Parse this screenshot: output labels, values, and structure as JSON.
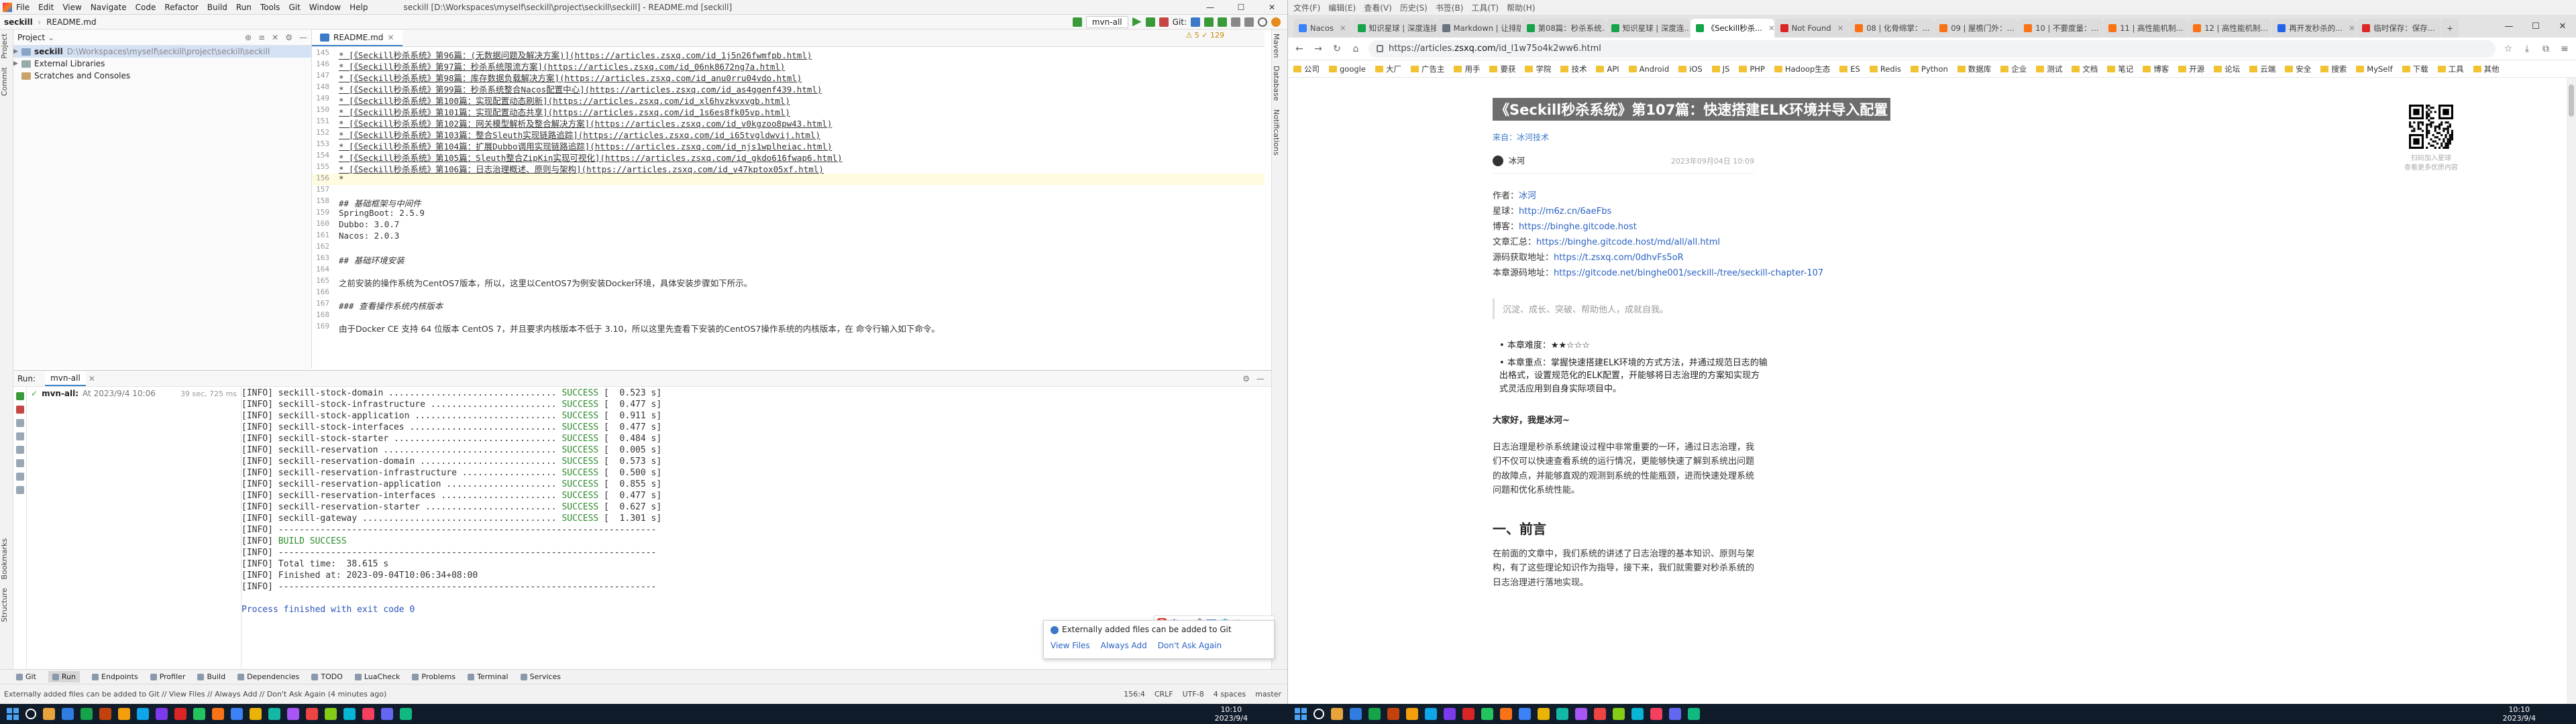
{
  "ide": {
    "title_menu": [
      "File",
      "Edit",
      "View",
      "Navigate",
      "Code",
      "Refactor",
      "Build",
      "Run",
      "Tools",
      "Git",
      "Window",
      "Help"
    ],
    "window_title": "seckill [D:\\Workspaces\\myself\\seckill\\project\\seckill\\seckill] - README.md [seckill]",
    "breadcrumb": [
      "seckill",
      "README.md"
    ],
    "run_config": "mvn-all",
    "git_label": "Git:",
    "project": {
      "header": "Project",
      "root_name": "seckill",
      "root_path": "D:\\Workspaces\\myself\\seckill\\project\\seckill\\seckill",
      "items": [
        "External Libraries",
        "Scratches and Consoles"
      ]
    },
    "editor_tab": "README.md",
    "warn_badge": "⚠ 5  ✓ 129",
    "code_lines": [
      {
        "n": "145",
        "t": "* [《Seckill秒杀系统》第96篇：(无数据问题及解决方案)](https://articles.zsxq.com/id_1j5n26fwmfpb.html)",
        "cls": "lk"
      },
      {
        "n": "146",
        "t": "* [《Seckill秒杀系统》第97篇：秒杀系统限流方案](https://articles.zsxq.com/id_06nk8672ng7a.html)",
        "cls": "lk"
      },
      {
        "n": "147",
        "t": "* [《Seckill秒杀系统》第98篇：库存数据负载解决方案](https://articles.zsxq.com/id_anu0rru04vdo.html)",
        "cls": "lk"
      },
      {
        "n": "148",
        "t": "* [《Seckill秒杀系统》第99篇：秒杀系统整合Nacos配置中心](https://articles.zsxq.com/id_as4ggenf439.html)",
        "cls": "lk"
      },
      {
        "n": "149",
        "t": "* [《Seckill秒杀系统》第100篇：实现配置动态刷新](https://articles.zsxq.com/id_xl6hvzkvxvgb.html)",
        "cls": "lk"
      },
      {
        "n": "150",
        "t": "* [《Seckill秒杀系统》第101篇：实现配置动态共享](https://articles.zsxq.com/id_1s6es8fk05vp.html)",
        "cls": "lk"
      },
      {
        "n": "151",
        "t": "* [《Seckill秒杀系统》第102篇：网关模型解析及整合解决方案](https://articles.zsxq.com/id_v0kgzoo8pw43.html)",
        "cls": "lk"
      },
      {
        "n": "152",
        "t": "* [《Seckill秒杀系统》第103篇：整合Sleuth实现链路追踪](https://articles.zsxq.com/id_i65tvgldwvij.html)",
        "cls": "lk"
      },
      {
        "n": "153",
        "t": "* [《Seckill秒杀系统》第104篇：扩展Dubbo调用实现链路追踪](https://articles.zsxq.com/id_njs1wplheiac.html)",
        "cls": "lk"
      },
      {
        "n": "154",
        "t": "* [《Seckill秒杀系统》第105篇：Sleuth整合ZipKin实现可视化](https://articles.zsxq.com/id_gkdo616fwap6.html)",
        "cls": "lk"
      },
      {
        "n": "155",
        "t": "* [《Seckill秒杀系统》第106篇：日志治理概述、原则与架构](https://articles.zsxq.com/id_v47kptox05xf.html)",
        "cls": "lk"
      },
      {
        "n": "156",
        "t": "*",
        "cls": "caret"
      },
      {
        "n": "157",
        "t": "",
        "cls": ""
      },
      {
        "n": "158",
        "t": "## 基础框架与中间件",
        "cls": "hd"
      },
      {
        "n": "159",
        "t": "SpringBoot: 2.5.9",
        "cls": ""
      },
      {
        "n": "160",
        "t": "Dubbo: 3.0.7",
        "cls": ""
      },
      {
        "n": "161",
        "t": "Nacos: 2.0.3",
        "cls": ""
      },
      {
        "n": "162",
        "t": "",
        "cls": ""
      },
      {
        "n": "163",
        "t": "## 基础环境安装",
        "cls": "hd"
      },
      {
        "n": "164",
        "t": "",
        "cls": ""
      },
      {
        "n": "165",
        "t": "之前安装的操作系统为CentOS7版本，所以，这里以CentOS7为例安装Docker环境，具体安装步骤如下所示。",
        "cls": "plain"
      },
      {
        "n": "166",
        "t": "",
        "cls": ""
      },
      {
        "n": "167",
        "t": "### 查看操作系统内核版本",
        "cls": "hd"
      },
      {
        "n": "168",
        "t": "",
        "cls": ""
      },
      {
        "n": "169",
        "t": "由于Docker CE 支持 64 位版本 CentOS 7，并且要求内核版本不低于 3.10，所以这里先查看下安装的CentOS7操作系统的内核版本，在 命令行输入如下命令。",
        "cls": "plain"
      }
    ],
    "run": {
      "label": "Run:",
      "tab": "mvn-all",
      "tree_item": "mvn-all:",
      "tree_time_label": "At 2023/9/4 10:06",
      "tree_time": "39 sec, 725 ms"
    },
    "console_lines": [
      [
        "[INFO] seckill-stock-domain ................................ ",
        "SUCCESS",
        " [  0.523 s]"
      ],
      [
        "[INFO] seckill-stock-infrastructure ........................ ",
        "SUCCESS",
        " [  0.477 s]"
      ],
      [
        "[INFO] seckill-stock-application ........................... ",
        "SUCCESS",
        " [  0.911 s]"
      ],
      [
        "[INFO] seckill-stock-interfaces ............................ ",
        "SUCCESS",
        " [  0.477 s]"
      ],
      [
        "[INFO] seckill-stock-starter ............................... ",
        "SUCCESS",
        " [  0.484 s]"
      ],
      [
        "[INFO] seckill-reservation ................................. ",
        "SUCCESS",
        " [  0.005 s]"
      ],
      [
        "[INFO] seckill-reservation-domain .......................... ",
        "SUCCESS",
        " [  0.573 s]"
      ],
      [
        "[INFO] seckill-reservation-infrastructure .................. ",
        "SUCCESS",
        " [  0.500 s]"
      ],
      [
        "[INFO] seckill-reservation-application ..................... ",
        "SUCCESS",
        " [  0.855 s]"
      ],
      [
        "[INFO] seckill-reservation-interfaces ...................... ",
        "SUCCESS",
        " [  0.477 s]"
      ],
      [
        "[INFO] seckill-reservation-starter ......................... ",
        "SUCCESS",
        " [  0.627 s]"
      ],
      [
        "[INFO] seckill-gateway ..................................... ",
        "SUCCESS",
        " [  1.301 s]"
      ]
    ],
    "console_tail": {
      "sep1": "[INFO] ------------------------------------------------------------------------",
      "build_prefix": "[INFO] ",
      "build": "BUILD SUCCESS",
      "sep2": "[INFO] ------------------------------------------------------------------------",
      "total": "[INFO] Total time:  38.615 s",
      "finished": "[INFO] Finished at: 2023-09-04T10:06:34+08:00",
      "sep3": "[INFO] ------------------------------------------------------------------------",
      "exit": "Process finished with exit code 0"
    },
    "notification": {
      "text": "Externally added files can be added to Git",
      "actions": [
        "View Files",
        "Always Add",
        "Don't Ask Again"
      ]
    },
    "ime": [
      "中",
      "•,",
      "🎤",
      "⌨",
      "👕",
      "▦"
    ],
    "bottom_tabs": [
      "Git",
      "Run",
      "Endpoints",
      "Profiler",
      "Build",
      "Dependencies",
      "TODO",
      "LuaCheck",
      "Problems",
      "Terminal",
      "Services"
    ],
    "status_left": "Externally added files can be added to Git // View Files // Always Add // Don't Ask Again (4 minutes ago)",
    "status_right": [
      "156:4",
      "CRLF",
      "UTF-8",
      "4 spaces",
      "master"
    ],
    "left_vtabs": [
      "Project",
      "Commit"
    ],
    "left_vtabs_bottom": [
      "Bookmarks",
      "Structure"
    ],
    "right_vtabs": [
      "Maven",
      "Database",
      "Notifications"
    ]
  },
  "browser": {
    "menu": [
      "文件(F)",
      "编辑(E)",
      "查看(V)",
      "历史(S)",
      "书签(B)",
      "工具(T)",
      "帮助(H)"
    ],
    "tabs": [
      {
        "label": "Nacos",
        "color": "#3b82f6",
        "active": false
      },
      {
        "label": "知识星球 | 深度连接...",
        "color": "#16a34a",
        "active": false
      },
      {
        "label": "Markdown | 让排版...",
        "color": "#6b7280",
        "active": false
      },
      {
        "label": "第08篇：秒杀系统...",
        "color": "#16a34a",
        "active": false
      },
      {
        "label": "知识星球 | 深度连...",
        "color": "#16a34a",
        "active": false
      },
      {
        "label": "《Seckill秒杀...",
        "color": "#16a34a",
        "active": true
      },
      {
        "label": "Not Found",
        "color": "#dc2626",
        "active": false
      },
      {
        "label": "08 | 化骨绵掌：...",
        "color": "#f97316",
        "active": false
      },
      {
        "label": "09 | 屋檐门外：...",
        "color": "#f97316",
        "active": false
      },
      {
        "label": "10 | 不要度量：...",
        "color": "#f97316",
        "active": false
      },
      {
        "label": "11 | 高性能机制...",
        "color": "#f97316",
        "active": false
      },
      {
        "label": "12 | 高性能机制...",
        "color": "#f97316",
        "active": false
      },
      {
        "label": "再开发秒杀的...",
        "color": "#2563eb",
        "active": false
      },
      {
        "label": "临时保存：保存...",
        "color": "#dc2626",
        "active": false
      }
    ],
    "url_prefix": "https://articles.",
    "url_domain": "zsxq.com",
    "url_rest": "/id_l1w75o4k2ww6.html",
    "bookmarks": [
      "公司",
      "google",
      "大厂",
      "广告主",
      "用手",
      "要获",
      "学院",
      "技术",
      "API",
      "Android",
      "iOS",
      "JS",
      "PHP",
      "Hadoop生态",
      "ES",
      "Redis",
      "Python",
      "数据库",
      "企业",
      "测试",
      "文档",
      "笔记",
      "博客",
      "开源",
      "论坛",
      "云端",
      "安全",
      "搜索",
      "MySelf",
      "下载",
      "工具",
      "其他"
    ],
    "article": {
      "title": "《Seckill秒杀系统》第107篇：快速搭建ELK环境并导入配置",
      "source": "来自：冰河技术",
      "author": "冰河",
      "date": "2023年09月04日 10:09",
      "info": [
        {
          "k": "作者：",
          "v": "冰河"
        },
        {
          "k": "星球：",
          "v": "http://m6z.cn/6aeFbs"
        },
        {
          "k": "博客：",
          "v": "https://binghe.gitcode.host"
        },
        {
          "k": "文章汇总：",
          "v": "https://binghe.gitcode.host/md/all/all.html"
        },
        {
          "k": "源码获取地址：",
          "v": "https://t.zsxq.com/0dhvFs5oR"
        },
        {
          "k": "本章源码地址：",
          "v": "https://gitcode.net/binghe001/seckill-/tree/seckill-chapter-107"
        }
      ],
      "quote": "沉淀、成长、突破、帮助他人，成就自我。",
      "bullets": [
        "本章难度：★★☆☆☆",
        "本章重点：掌握快速搭建ELK环境的方式方法，并通过规范日志的输出格式，设置规范化的ELK配置，开能够将日志治理的方案知实现方式灵活应用到自身实际项目中。"
      ],
      "greeting": "大家好，我是冰河~",
      "para1": "日志治理是秒杀系统建设过程中非常重要的一环，通过日志治理，我们不仅可以快速查看系统的运行情况，更能够快速了解到系统出问题的故障点，并能够直观的观测到系统的性能瓶颈，进而快速处理系统问题和优化系统性能。",
      "section1": "一、前言",
      "para2": "在前面的文章中，我们系统的讲述了日志治理的基本知识、原则与架构，有了这些理论知识作为指导，接下来，我们就需要对秒杀系统的日志治理进行落地实现。",
      "qr_caption_1": "扫码加入星球",
      "qr_caption_2": "查看更多优质内容"
    }
  },
  "taskbar": {
    "left_time": "10:10",
    "left_date": "2023/9/4",
    "right_time": "10:10",
    "right_date": "2023/9/4",
    "app_colors": [
      "#e8a33d",
      "#2f7de1",
      "#17a34a",
      "#c2410c",
      "#f59e0b",
      "#0ea5e9",
      "#7c3aed",
      "#dc2626",
      "#22c55e",
      "#f97316",
      "#3b82f6",
      "#eab308",
      "#14b8a6",
      "#a855f7",
      "#ef4444",
      "#84cc16",
      "#06b6d4",
      "#f43f5e",
      "#6366f1",
      "#10b981"
    ]
  }
}
